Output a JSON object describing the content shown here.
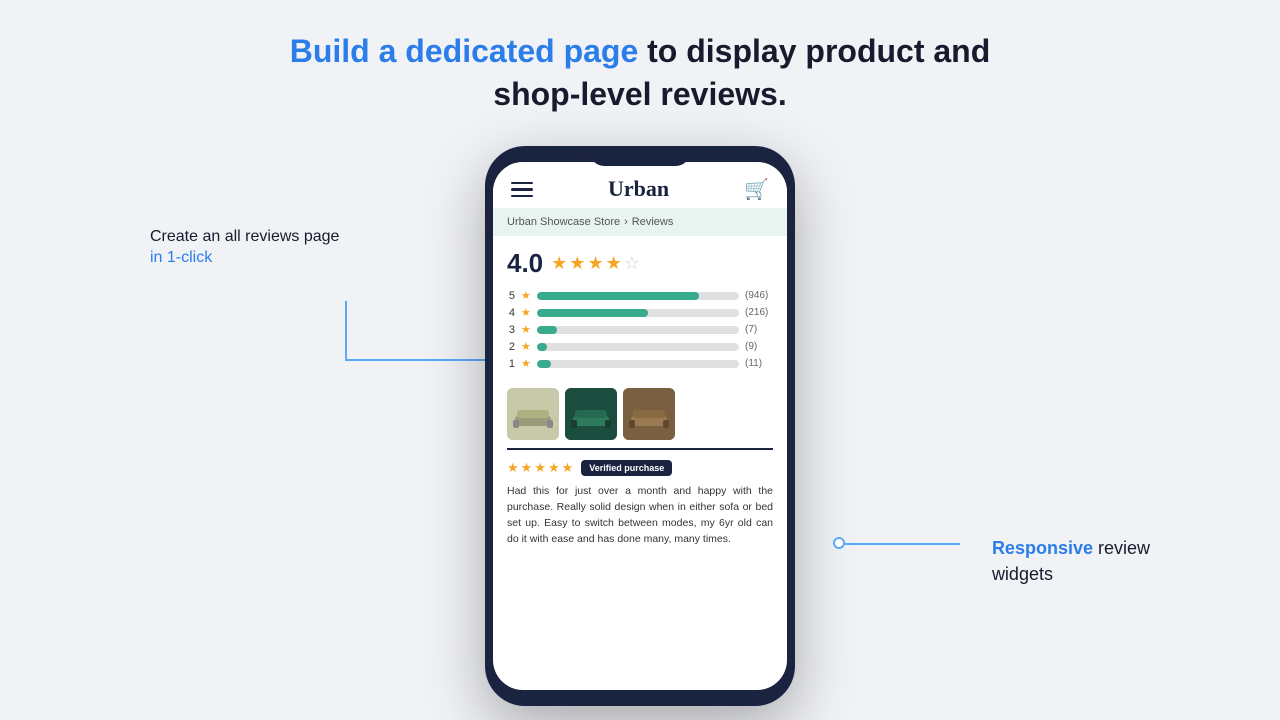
{
  "headline": {
    "part1": "Build a dedicated page",
    "part2": " to display product and",
    "part3": "shop-level reviews."
  },
  "left_callout": {
    "line1": "Create an all reviews page",
    "line2": "in 1-click"
  },
  "right_callout": {
    "highlight": "Responsive",
    "rest": " review\nwidgets"
  },
  "phone": {
    "store_name": "Urban",
    "breadcrumb": {
      "parent": "Urban Showcase Store",
      "separator": "›",
      "current": "Reviews"
    },
    "overall_rating": "4.0",
    "bars": [
      {
        "stars": 5,
        "count": "(946)",
        "pct": 80
      },
      {
        "stars": 4,
        "count": "(216)",
        "pct": 55
      },
      {
        "stars": 3,
        "count": "(7)",
        "pct": 10
      },
      {
        "stars": 2,
        "count": "(9)",
        "pct": 5
      },
      {
        "stars": 1,
        "count": "(11)",
        "pct": 7
      }
    ],
    "verified_label": "Verified purchase",
    "review_text": "Had this for just over a month and happy with the purchase. Really solid design when in either sofa or bed set up. Easy to switch between modes, my 6yr old can do it with ease and has done many, many times."
  }
}
